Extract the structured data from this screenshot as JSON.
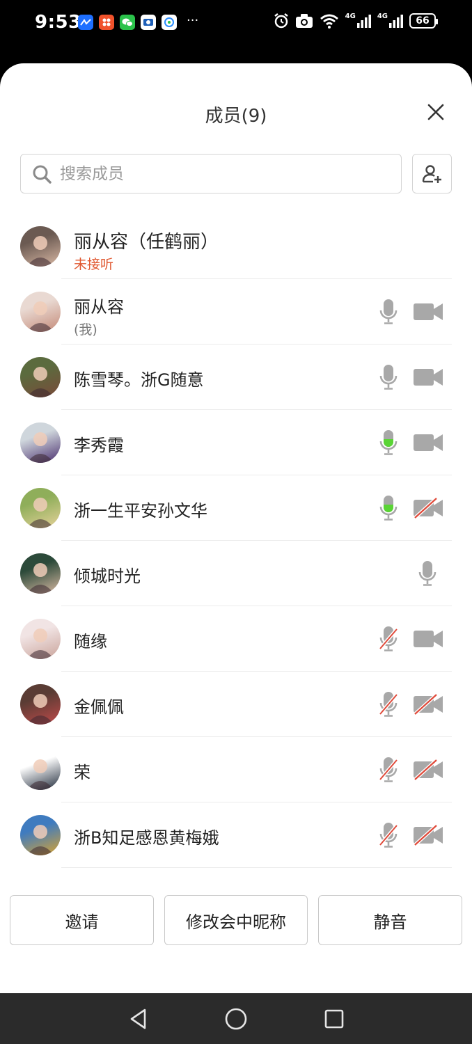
{
  "status_bar": {
    "time": "9:53",
    "network_label_1": "4G",
    "network_label_2": "4G",
    "battery": "66",
    "overflow": "···"
  },
  "header": {
    "title": "成员(9)"
  },
  "search": {
    "placeholder": "搜索成员"
  },
  "members": [
    {
      "name": "丽从容（任鹤丽）",
      "sub": "未接听",
      "sub_color": "#e0572f",
      "mic": "none",
      "cam": "none",
      "avatar_colors": [
        "#6b5a52",
        "#d9b8a4"
      ]
    },
    {
      "name": "丽从容",
      "sub": "(我)",
      "sub_color": "#777777",
      "mic": "on",
      "cam": "on",
      "avatar_colors": [
        "#e9d9d2",
        "#c48a78"
      ]
    },
    {
      "name": "陈雪琴。浙G随意",
      "sub": "",
      "mic": "on",
      "cam": "on",
      "avatar_colors": [
        "#5b6b3e",
        "#7a4a3a"
      ]
    },
    {
      "name": "李秀霞",
      "sub": "",
      "mic": "active",
      "cam": "on",
      "avatar_colors": [
        "#cfd6dc",
        "#4a2f6e"
      ]
    },
    {
      "name": "浙一生平安孙文华",
      "sub": "",
      "mic": "active",
      "cam": "off",
      "avatar_colors": [
        "#8fae5a",
        "#e6d29a"
      ]
    },
    {
      "name": "倾城时光",
      "sub": "",
      "mic": "on",
      "cam": "none",
      "avatar_colors": [
        "#2c4a3a",
        "#d8b9a2"
      ]
    },
    {
      "name": "随缘",
      "sub": "",
      "mic": "off",
      "cam": "on",
      "avatar_colors": [
        "#f1e4e4",
        "#c9a39a"
      ]
    },
    {
      "name": "金佩佩",
      "sub": "",
      "mic": "off",
      "cam": "off",
      "avatar_colors": [
        "#5a3c34",
        "#c04a4a"
      ]
    },
    {
      "name": "荣",
      "sub": "",
      "mic": "off",
      "cam": "off",
      "avatar_colors": [
        "#ffffff",
        "#1f2a3a"
      ]
    },
    {
      "name": "浙B知足感恩黄梅娥",
      "sub": "",
      "mic": "off",
      "cam": "off",
      "avatar_colors": [
        "#3f7bbf",
        "#d9a331"
      ]
    }
  ],
  "buttons": {
    "invite": "邀请",
    "rename": "修改会中昵称",
    "mute": "静音"
  },
  "colors": {
    "icon_gray": "#a8a8a8",
    "active_green": "#5ad435",
    "slash_red": "#e04a3a",
    "missed_orange": "#e0572f"
  }
}
